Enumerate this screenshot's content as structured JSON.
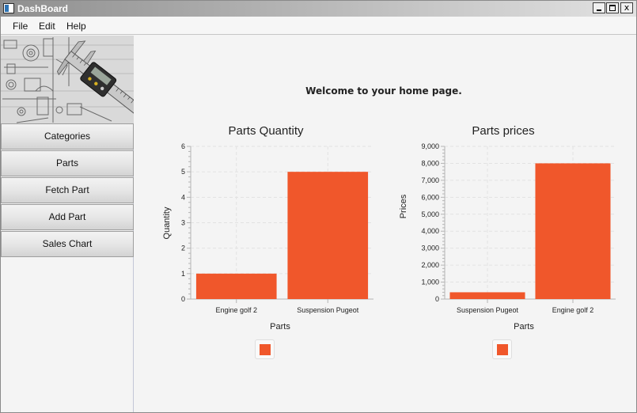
{
  "window": {
    "title": "DashBoard",
    "controls": {
      "minimize": "",
      "maximize": "",
      "close": "x"
    }
  },
  "menu": {
    "items": [
      "File",
      "Edit",
      "Help"
    ]
  },
  "sidebar": {
    "banner_icon": "caliper-on-blueprint-image",
    "buttons": [
      "Categories",
      "Parts",
      "Fetch Part",
      "Add Part",
      "Sales Chart"
    ]
  },
  "main": {
    "welcome": "Welcome to your home page."
  },
  "colors": {
    "bar": "#f0572b",
    "grid": "#e2e2e2",
    "axis": "#b5b5b5"
  },
  "chart_data": [
    {
      "type": "bar",
      "title": "Parts Quantity",
      "xlabel": "Parts",
      "ylabel": "Quantity",
      "categories": [
        "Engine golf 2",
        "Suspension Pugeot"
      ],
      "values": [
        1,
        5
      ],
      "ylim": [
        0,
        6
      ],
      "yticks": [
        "0",
        "1",
        "2",
        "3",
        "4",
        "5",
        "6"
      ],
      "grid": true,
      "legend": "bottom"
    },
    {
      "type": "bar",
      "title": "Parts prices",
      "xlabel": "Parts",
      "ylabel": "Prices",
      "categories": [
        "Suspension Pugeot",
        "Engine golf 2"
      ],
      "values": [
        400,
        8000
      ],
      "ylim": [
        0,
        9000
      ],
      "yticks": [
        "0",
        "1,000",
        "2,000",
        "3,000",
        "4,000",
        "5,000",
        "6,000",
        "7,000",
        "8,000",
        "9,000"
      ],
      "grid": true,
      "legend": "bottom"
    }
  ]
}
